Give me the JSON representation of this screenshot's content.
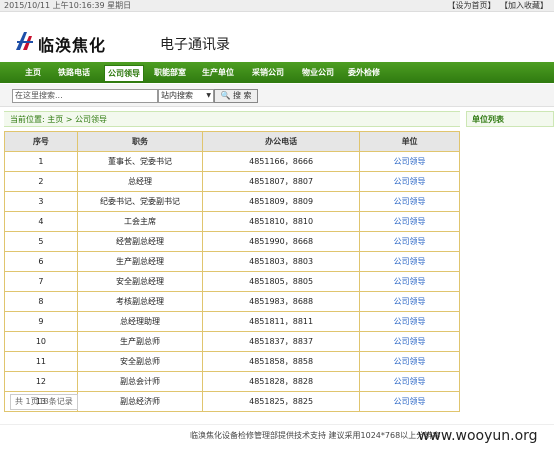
{
  "topbar": {
    "datetime": "2015/10/11 上午10:16:39 星期日",
    "set_home": "【设为首页】",
    "add_fav": "【加入收藏】"
  },
  "header": {
    "logo_text": "临涣焦化",
    "site_title": "电子通讯录"
  },
  "nav": {
    "items": [
      "主页",
      "铁路电话",
      "公司领导",
      "职能部室",
      "生产单位",
      "采销公司",
      "物业公司",
      "委外检修"
    ],
    "active_index": 2
  },
  "search": {
    "placeholder": "在这里搜索...",
    "scope": "站内搜索",
    "button": "搜 索"
  },
  "breadcrumb": {
    "label": "当前位置:",
    "home": "主页",
    "sep": ">",
    "current": "公司领导"
  },
  "unit_panel": {
    "title": "单位列表"
  },
  "table": {
    "headers": [
      "序号",
      "职务",
      "办公电话",
      "单位"
    ],
    "rows": [
      [
        "1",
        "董事长、党委书记",
        "4851166，8666",
        "公司领导"
      ],
      [
        "2",
        "总经理",
        "4851807，8807",
        "公司领导"
      ],
      [
        "3",
        "纪委书记、党委副书记",
        "4851809，8809",
        "公司领导"
      ],
      [
        "4",
        "工会主席",
        "4851810，8810",
        "公司领导"
      ],
      [
        "5",
        "经营副总经理",
        "4851990，8668",
        "公司领导"
      ],
      [
        "6",
        "生产副总经理",
        "4851803，8803",
        "公司领导"
      ],
      [
        "7",
        "安全副总经理",
        "4851805，8805",
        "公司领导"
      ],
      [
        "8",
        "考核副总经理",
        "4851983，8688",
        "公司领导"
      ],
      [
        "9",
        "总经理助理",
        "4851811，8811",
        "公司领导"
      ],
      [
        "10",
        "生产副总师",
        "4851837，8837",
        "公司领导"
      ],
      [
        "11",
        "安全副总师",
        "4851858，8858",
        "公司领导"
      ],
      [
        "12",
        "副总会计师",
        "4851828，8828",
        "公司领导"
      ],
      [
        "13",
        "副总经济师",
        "4851825，8825",
        "公司领导"
      ]
    ]
  },
  "pager": {
    "text": "共 1页13条记录"
  },
  "footer": {
    "text": "临涣焦化设备检修管理部提供技术支持 建议采用1024*768以上分辨率",
    "watermark": "www.wooyun.org"
  }
}
